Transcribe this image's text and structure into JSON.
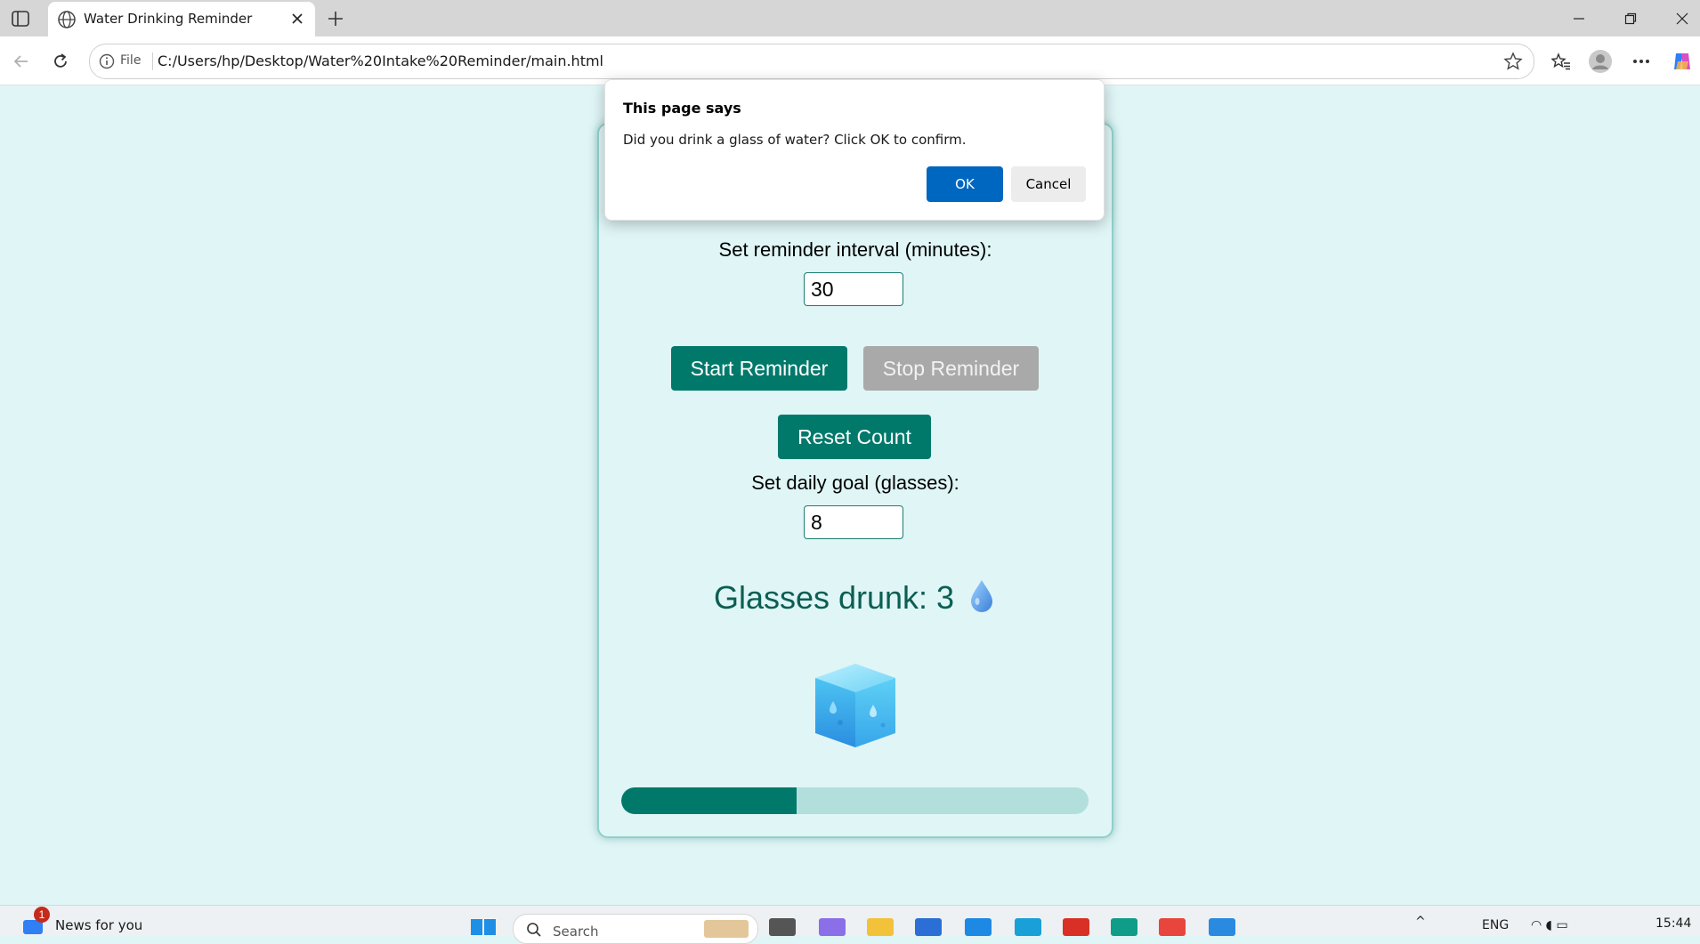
{
  "browser": {
    "tab_title": "Water Drinking Reminder",
    "address_scheme": "File",
    "url": "C:/Users/hp/Desktop/Water%20Intake%20Reminder/main.html"
  },
  "app": {
    "interval_label": "Set reminder interval (minutes):",
    "interval_value": "30",
    "start_label": "Start Reminder",
    "stop_label": "Stop Reminder",
    "reset_label": "Reset Count",
    "goal_label": "Set daily goal (glasses):",
    "goal_value": "8",
    "glasses_text": "Glasses drunk: 3",
    "glasses_count": 3,
    "progress_fraction": 0.375,
    "colors": {
      "primary": "#00796b",
      "track": "#b2dfdb",
      "background": "#dff5f6",
      "disabled": "#a9a9a9"
    }
  },
  "dialog": {
    "title": "This page says",
    "message": "Did you drink a glass of water? Click OK to confirm.",
    "ok_label": "OK",
    "cancel_label": "Cancel"
  },
  "taskbar": {
    "news_badge": "1",
    "news_label": "News for you",
    "search_placeholder": "Search",
    "language": "ENG",
    "time": "15:44"
  }
}
